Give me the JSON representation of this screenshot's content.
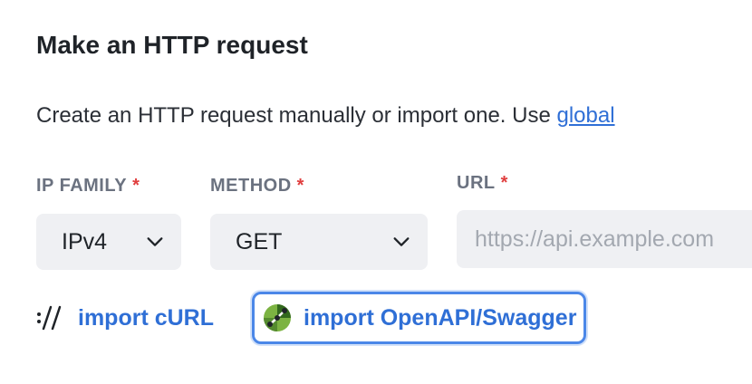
{
  "page": {
    "title": "Make an HTTP request",
    "description_text": "Create an HTTP request manually or import one. Use ",
    "description_link": "global"
  },
  "form": {
    "ip_family": {
      "label": "IP FAMILY",
      "required_mark": "*",
      "value": "IPv4"
    },
    "method": {
      "label": "METHOD",
      "required_mark": "*",
      "value": "GET"
    },
    "url": {
      "label": "URL",
      "required_mark": "*",
      "value": "",
      "placeholder": "https://api.example.com"
    }
  },
  "imports": {
    "curl_label": "import cURL",
    "swagger_label": "import OpenAPI/Swagger"
  },
  "colors": {
    "link": "#2f6fd6",
    "required": "#e03e3e",
    "field_bg": "#eff0f3",
    "focus_ring": "#4b87e8"
  },
  "icons": {
    "curl": "curl-icon",
    "swagger": "swagger-icon",
    "select_arrow": "chevron-down-icon"
  }
}
